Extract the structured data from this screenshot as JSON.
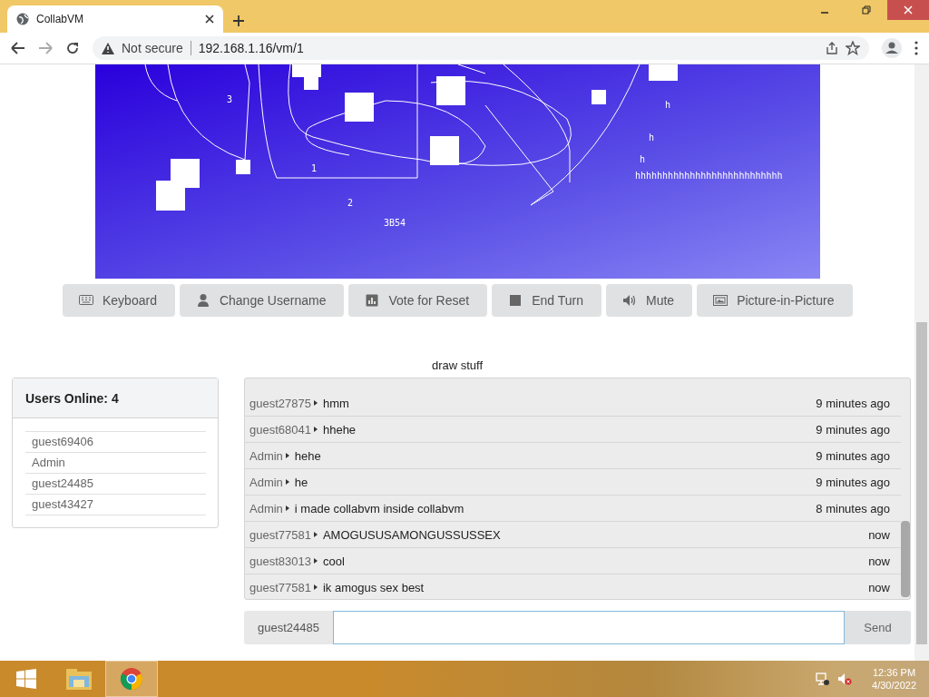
{
  "browser": {
    "tab_title": "CollabVM",
    "security": "Not secure",
    "url": "192.168.1.16/vm/1"
  },
  "vm_screen": {
    "labels": [
      "3",
      "1",
      "2",
      "3B54",
      "h",
      "h",
      "h",
      "hhhhhhhhhhhhhhhhhhhhhhhhhhh"
    ]
  },
  "buttons": [
    "Keyboard",
    "Change Username",
    "Vote for Reset",
    "End Turn",
    "Mute",
    "Picture-in-Picture"
  ],
  "vm_title": "draw stuff",
  "users": {
    "title": "Users Online: 4",
    "items": [
      "guest69406",
      "Admin",
      "guest24485",
      "guest43427"
    ]
  },
  "chat": {
    "messages": [
      {
        "user": "guest27875",
        "text": "hmm",
        "time": "9 minutes ago"
      },
      {
        "user": "guest68041",
        "text": "hhehe",
        "time": "9 minutes ago"
      },
      {
        "user": "Admin",
        "text": "hehe",
        "time": "9 minutes ago"
      },
      {
        "user": "Admin",
        "text": "he",
        "time": "9 minutes ago"
      },
      {
        "user": "Admin",
        "text": "i made collabvm inside collabvm",
        "time": "8 minutes ago"
      },
      {
        "user": "guest77581",
        "text": "AMOGUSUSAMONGUSSUSSEX",
        "time": "now"
      },
      {
        "user": "guest83013",
        "text": "cool",
        "time": "now"
      },
      {
        "user": "guest77581",
        "text": "ik amogus sex best",
        "time": "now"
      }
    ]
  },
  "chat_input": {
    "username": "guest24485",
    "send": "Send"
  },
  "taskbar": {
    "time": "12:36 PM",
    "date": "4/30/2022"
  }
}
